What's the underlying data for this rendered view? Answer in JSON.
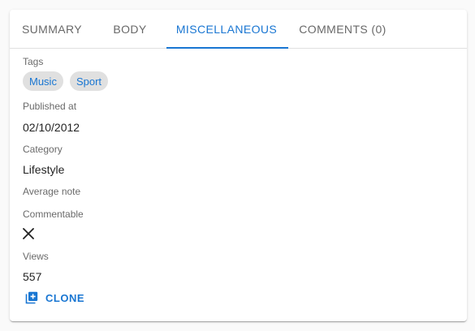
{
  "tabs": [
    {
      "label": "Summary"
    },
    {
      "label": "Body"
    },
    {
      "label": "Miscellaneous",
      "active": true
    },
    {
      "label": "Comments (0)"
    }
  ],
  "fields": {
    "tags": {
      "label": "Tags",
      "items": [
        "Music",
        "Sport"
      ]
    },
    "published_at": {
      "label": "Published at",
      "value": "02/10/2012"
    },
    "category": {
      "label": "Category",
      "value": "Lifestyle"
    },
    "average_note": {
      "label": "Average note",
      "value": ""
    },
    "commentable": {
      "label": "Commentable",
      "icon": "close-icon",
      "value": false
    },
    "views": {
      "label": "Views",
      "value": "557"
    }
  },
  "actions": {
    "clone_label": "Clone",
    "clone_icon": "library-add-icon"
  },
  "colors": {
    "accent": "#1976d2",
    "chip_bg": "#e0e0e0"
  }
}
